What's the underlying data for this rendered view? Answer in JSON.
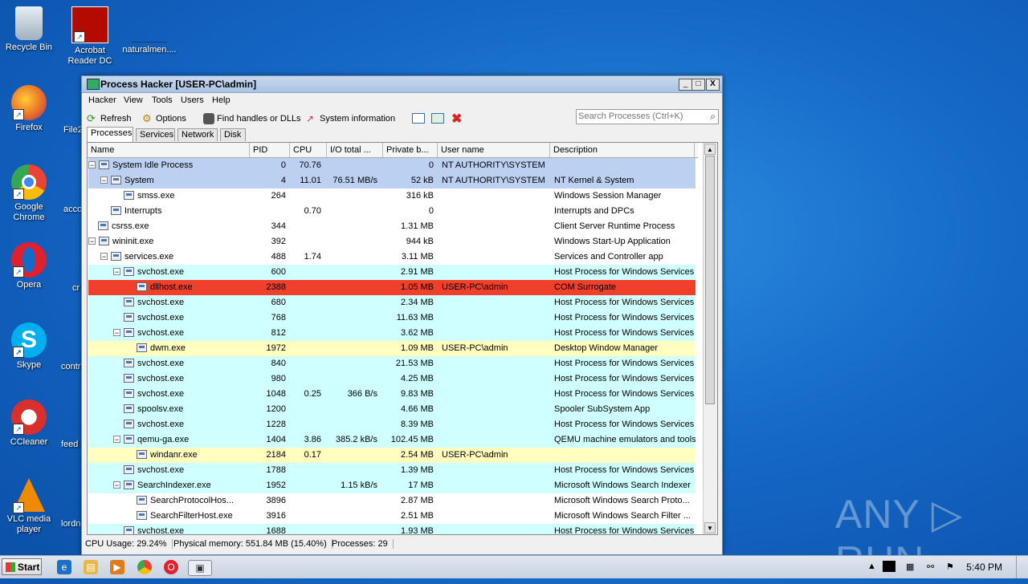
{
  "desktop": {
    "icons": [
      {
        "id": "recycle-bin",
        "label": "Recycle Bin",
        "color": "#cfd8e0"
      },
      {
        "id": "acrobat",
        "label": "Acrobat Reader DC",
        "color": "#b30b00"
      },
      {
        "id": "naturalmen",
        "label": "naturalmen...."
      },
      {
        "id": "firefox",
        "label": "Firefox",
        "color": "#e8682a"
      },
      {
        "id": "chrome",
        "label": "Google Chrome",
        "color": "#34a853"
      },
      {
        "id": "opera",
        "label": "Opera",
        "color": "#e0202d"
      },
      {
        "id": "skype",
        "label": "Skype",
        "color": "#00aff0"
      },
      {
        "id": "ccleaner",
        "label": "CCleaner",
        "color": "#d9302c"
      },
      {
        "id": "vlc",
        "label": "VLC media player",
        "color": "#f08a00"
      }
    ],
    "partial_labels": [
      "File2",
      "acco",
      "cr",
      "contr",
      "feed",
      "lordn"
    ],
    "watermark": "ANY ▷ RUN"
  },
  "window": {
    "title": "Process Hacker [USER-PC\\admin]",
    "controls": {
      "minimize": "_",
      "maximize": "□",
      "close": "X"
    },
    "menu": [
      "Hacker",
      "View",
      "Tools",
      "Users",
      "Help"
    ],
    "toolbar": {
      "refresh": "Refresh",
      "options": "Options",
      "find": "Find handles or DLLs",
      "sysinfo": "System information"
    },
    "search_placeholder": "Search Processes (Ctrl+K)",
    "tabs": [
      "Processes",
      "Services",
      "Network",
      "Disk"
    ],
    "columns": {
      "name": "Name",
      "pid": "PID",
      "cpu": "CPU",
      "io": "I/O total ...",
      "priv": "Private b...",
      "user": "User name",
      "desc": "Description"
    },
    "status": {
      "cpu": "CPU Usage: 29.24%",
      "mem": "Physical memory: 551.84 MB (15.40%)",
      "procs": "Processes: 29"
    }
  },
  "colors": {
    "system": "#bcd1f2",
    "service": "#d0ffff",
    "user": "#ffffc0",
    "highlight": "#f0402c",
    "normal": "#ffffff"
  },
  "processes": [
    {
      "name": "System Idle Process",
      "depth": 0,
      "exp": "⊟",
      "pid": "0",
      "cpu": "70.76",
      "io": "",
      "priv": "0",
      "user": "NT AUTHORITY\\SYSTEM",
      "desc": "",
      "kind": "system"
    },
    {
      "name": "System",
      "depth": 1,
      "exp": "⊟",
      "pid": "4",
      "cpu": "11.01",
      "io": "76.51 MB/s",
      "priv": "52 kB",
      "user": "NT AUTHORITY\\SYSTEM",
      "desc": "NT Kernel & System",
      "kind": "system"
    },
    {
      "name": "smss.exe",
      "depth": 2,
      "exp": "",
      "pid": "264",
      "cpu": "",
      "io": "",
      "priv": "316 kB",
      "user": "",
      "desc": "Windows Session Manager",
      "kind": "normal"
    },
    {
      "name": "Interrupts",
      "depth": 1,
      "exp": "",
      "pid": "",
      "cpu": "0.70",
      "io": "",
      "priv": "0",
      "user": "",
      "desc": "Interrupts and DPCs",
      "kind": "normal"
    },
    {
      "name": "csrss.exe",
      "depth": 0,
      "exp": "",
      "pid": "344",
      "cpu": "",
      "io": "",
      "priv": "1.31 MB",
      "user": "",
      "desc": "Client Server Runtime Process",
      "kind": "normal"
    },
    {
      "name": "wininit.exe",
      "depth": 0,
      "exp": "⊟",
      "pid": "392",
      "cpu": "",
      "io": "",
      "priv": "944 kB",
      "user": "",
      "desc": "Windows Start-Up Application",
      "kind": "normal"
    },
    {
      "name": "services.exe",
      "depth": 1,
      "exp": "⊟",
      "pid": "488",
      "cpu": "1.74",
      "io": "",
      "priv": "3.11 MB",
      "user": "",
      "desc": "Services and Controller app",
      "kind": "normal"
    },
    {
      "name": "svchost.exe",
      "depth": 2,
      "exp": "⊟",
      "pid": "600",
      "cpu": "",
      "io": "",
      "priv": "2.91 MB",
      "user": "",
      "desc": "Host Process for Windows Services",
      "kind": "service"
    },
    {
      "name": "dllhost.exe",
      "depth": 3,
      "exp": "",
      "pid": "2388",
      "cpu": "",
      "io": "",
      "priv": "1.05 MB",
      "user": "USER-PC\\admin",
      "desc": "COM Surrogate",
      "kind": "highlight"
    },
    {
      "name": "svchost.exe",
      "depth": 2,
      "exp": "",
      "pid": "680",
      "cpu": "",
      "io": "",
      "priv": "2.34 MB",
      "user": "",
      "desc": "Host Process for Windows Services",
      "kind": "service"
    },
    {
      "name": "svchost.exe",
      "depth": 2,
      "exp": "",
      "pid": "768",
      "cpu": "",
      "io": "",
      "priv": "11.63 MB",
      "user": "",
      "desc": "Host Process for Windows Services",
      "kind": "service"
    },
    {
      "name": "svchost.exe",
      "depth": 2,
      "exp": "⊟",
      "pid": "812",
      "cpu": "",
      "io": "",
      "priv": "3.62 MB",
      "user": "",
      "desc": "Host Process for Windows Services",
      "kind": "service"
    },
    {
      "name": "dwm.exe",
      "depth": 3,
      "exp": "",
      "pid": "1972",
      "cpu": "",
      "io": "",
      "priv": "1.09 MB",
      "user": "USER-PC\\admin",
      "desc": "Desktop Window Manager",
      "kind": "user"
    },
    {
      "name": "svchost.exe",
      "depth": 2,
      "exp": "",
      "pid": "840",
      "cpu": "",
      "io": "",
      "priv": "21.53 MB",
      "user": "",
      "desc": "Host Process for Windows Services",
      "kind": "service"
    },
    {
      "name": "svchost.exe",
      "depth": 2,
      "exp": "",
      "pid": "980",
      "cpu": "",
      "io": "",
      "priv": "4.25 MB",
      "user": "",
      "desc": "Host Process for Windows Services",
      "kind": "service"
    },
    {
      "name": "svchost.exe",
      "depth": 2,
      "exp": "",
      "pid": "1048",
      "cpu": "0.25",
      "io": "366 B/s",
      "priv": "9.83 MB",
      "user": "",
      "desc": "Host Process for Windows Services",
      "kind": "service"
    },
    {
      "name": "spoolsv.exe",
      "depth": 2,
      "exp": "",
      "pid": "1200",
      "cpu": "",
      "io": "",
      "priv": "4.66 MB",
      "user": "",
      "desc": "Spooler SubSystem App",
      "kind": "service"
    },
    {
      "name": "svchost.exe",
      "depth": 2,
      "exp": "",
      "pid": "1228",
      "cpu": "",
      "io": "",
      "priv": "8.39 MB",
      "user": "",
      "desc": "Host Process for Windows Services",
      "kind": "service"
    },
    {
      "name": "qemu-ga.exe",
      "depth": 2,
      "exp": "⊟",
      "pid": "1404",
      "cpu": "3.86",
      "io": "385.2 kB/s",
      "priv": "102.45 MB",
      "user": "",
      "desc": "QEMU machine emulators and tools",
      "kind": "service"
    },
    {
      "name": "windanr.exe",
      "depth": 3,
      "exp": "",
      "pid": "2184",
      "cpu": "0.17",
      "io": "",
      "priv": "2.54 MB",
      "user": "USER-PC\\admin",
      "desc": "",
      "kind": "user"
    },
    {
      "name": "svchost.exe",
      "depth": 2,
      "exp": "",
      "pid": "1788",
      "cpu": "",
      "io": "",
      "priv": "1.39 MB",
      "user": "",
      "desc": "Host Process for Windows Services",
      "kind": "service"
    },
    {
      "name": "SearchIndexer.exe",
      "depth": 2,
      "exp": "⊟",
      "pid": "1952",
      "cpu": "",
      "io": "1.15 kB/s",
      "priv": "17 MB",
      "user": "",
      "desc": "Microsoft Windows Search Indexer",
      "kind": "service"
    },
    {
      "name": "SearchProtocolHos...",
      "depth": 3,
      "exp": "",
      "pid": "3896",
      "cpu": "",
      "io": "",
      "priv": "2.87 MB",
      "user": "",
      "desc": "Microsoft Windows Search Proto...",
      "kind": "normal"
    },
    {
      "name": "SearchFilterHost.exe",
      "depth": 3,
      "exp": "",
      "pid": "3916",
      "cpu": "",
      "io": "",
      "priv": "2.51 MB",
      "user": "",
      "desc": "Microsoft Windows Search Filter ...",
      "kind": "normal"
    },
    {
      "name": "svchost.exe",
      "depth": 2,
      "exp": "",
      "pid": "1688",
      "cpu": "",
      "io": "",
      "priv": "1.93 MB",
      "user": "",
      "desc": "Host Process for Windows Services",
      "kind": "service"
    }
  ],
  "taskbar": {
    "start": "Start",
    "clock": "5:40 PM"
  }
}
